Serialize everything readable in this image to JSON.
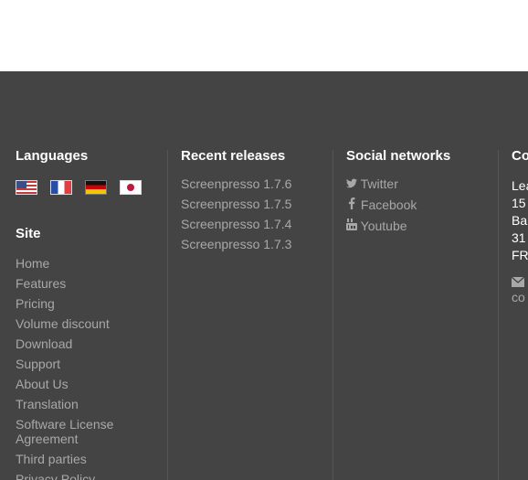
{
  "languages": {
    "title": "Languages",
    "flags": [
      {
        "name": "English",
        "icon": "us-flag-icon"
      },
      {
        "name": "French",
        "icon": "fr-flag-icon"
      },
      {
        "name": "German",
        "icon": "de-flag-icon"
      },
      {
        "name": "Japanese",
        "icon": "jp-flag-icon"
      }
    ]
  },
  "site": {
    "title": "Site",
    "items": [
      "Home",
      "Features",
      "Pricing",
      "Volume discount",
      "Download",
      "Support",
      "About Us",
      "Translation",
      "Software License",
      "Agreement",
      "Third parties",
      "Privacy Policy"
    ]
  },
  "releases": {
    "title": "Recent releases",
    "items": [
      "Screenpresso 1.7.6",
      "Screenpresso 1.7.5",
      "Screenpresso 1.7.4",
      "Screenpresso 1.7.3"
    ]
  },
  "social": {
    "title": "Social networks",
    "items": [
      {
        "label": "Twitter",
        "icon": "twitter-icon"
      },
      {
        "label": "Facebook",
        "icon": "facebook-icon"
      },
      {
        "label": "Youtube",
        "icon": "youtube-icon"
      }
    ]
  },
  "contact": {
    "title": "Co",
    "lines": [
      "Lea",
      "15",
      "Bar",
      "31",
      "FR"
    ],
    "email_fragment": "co"
  },
  "colors": {
    "footer_bg": "#444444",
    "heading": "#ffffff",
    "link": "#a8a8a8"
  }
}
